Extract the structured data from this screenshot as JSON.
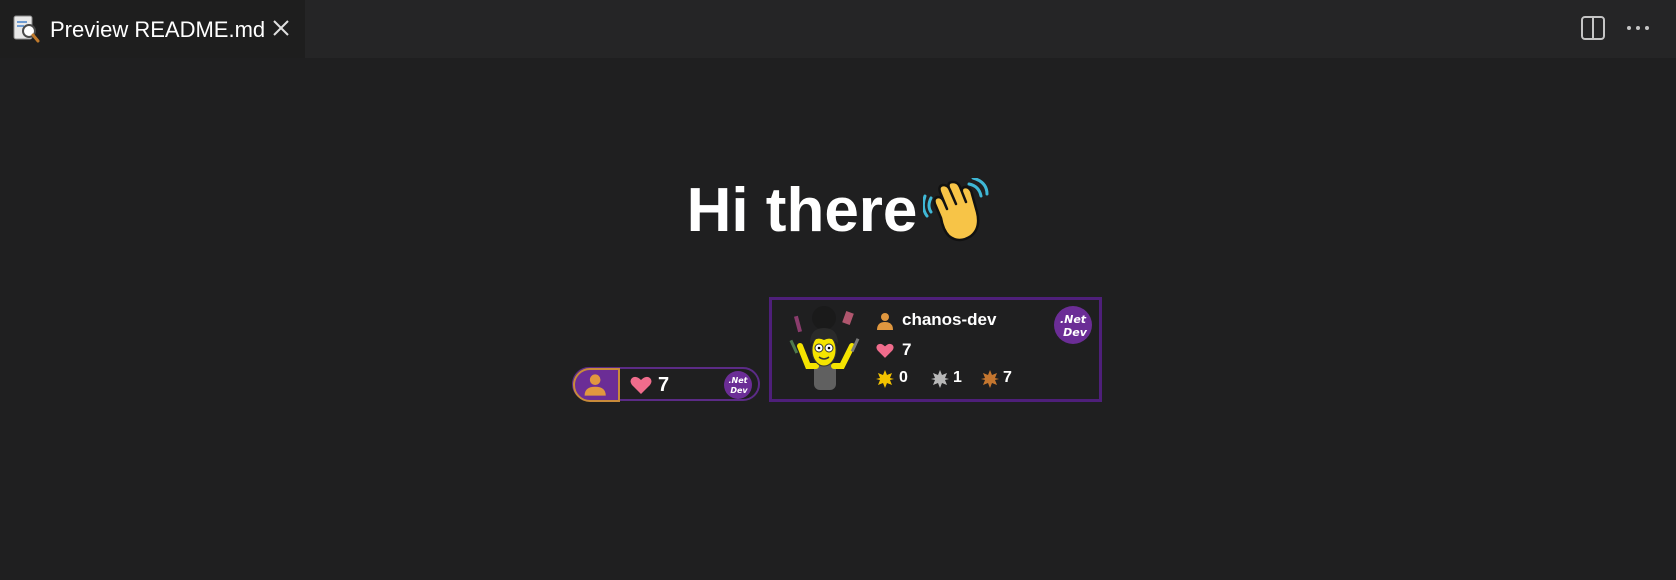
{
  "tab": {
    "label": "Preview README.md"
  },
  "icons": {
    "tab_icon": "preview-icon",
    "close": "close-icon",
    "split": "split-editor-icon",
    "more": "more-actions-icon"
  },
  "content": {
    "heading": "Hi there",
    "heading_emoji": "waving-hand"
  },
  "mini_badge": {
    "likes": "7",
    "logo_text": ".Net Dev"
  },
  "profile_card": {
    "username": "chanos-dev",
    "likes": "7",
    "logo_text": ".Net Dev",
    "medals": {
      "gold": "0",
      "silver": "1",
      "bronze": "7"
    }
  },
  "colors": {
    "background": "#1f1f20",
    "tabbar": "#252526",
    "accent_purple": "#6b2d96",
    "heart": "#f06c8c",
    "gold": "#f2c200",
    "silver": "#b8b8b8",
    "bronze": "#c4762f"
  }
}
